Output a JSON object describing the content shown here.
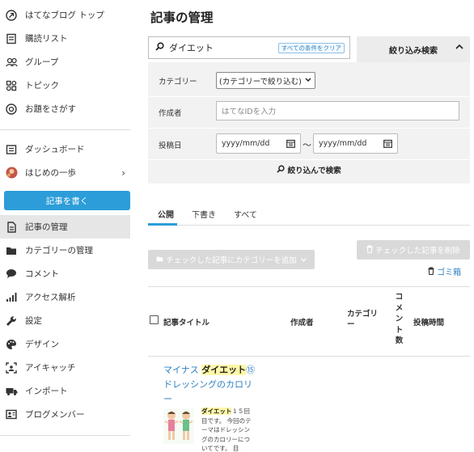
{
  "sidebar": {
    "items": [
      {
        "label": "はてなブログ トップ",
        "icon": "hatena-blog-icon"
      },
      {
        "label": "購読リスト",
        "icon": "reader-icon"
      },
      {
        "label": "グループ",
        "icon": "group-icon"
      },
      {
        "label": "トピック",
        "icon": "topic-icon"
      },
      {
        "label": "お題をさがす",
        "icon": "odai-icon"
      },
      {
        "label": "ダッシュボード",
        "icon": "dashboard-icon"
      },
      {
        "label": "はじめの一歩",
        "icon": "blog-avatar-icon"
      },
      {
        "label": "記事の管理",
        "icon": "document-icon"
      },
      {
        "label": "カテゴリーの管理",
        "icon": "folder-icon"
      },
      {
        "label": "コメント",
        "icon": "comment-icon"
      },
      {
        "label": "アクセス解析",
        "icon": "analytics-icon"
      },
      {
        "label": "設定",
        "icon": "wrench-icon"
      },
      {
        "label": "デザイン",
        "icon": "palette-icon"
      },
      {
        "label": "アイキャッチ",
        "icon": "eyecatch-icon"
      },
      {
        "label": "インポート",
        "icon": "truck-icon"
      },
      {
        "label": "ブログメンバー",
        "icon": "member-icon"
      }
    ],
    "write_button": "記事を書く",
    "active": "記事の管理"
  },
  "main": {
    "title": "記事の管理",
    "search": {
      "value": "ダイエット",
      "clear_label": "すべての条件をクリア"
    },
    "filter_toggle": "絞り込み検索",
    "filter": {
      "category_label": "カテゴリー",
      "category_value": "(カテゴリーで絞り込む)",
      "author_label": "作成者",
      "author_placeholder": "はてなIDを入力",
      "date_label": "投稿日",
      "date_from": "yyyy/mm/dd",
      "date_to": "yyyy/mm/dd",
      "range_sep": "〜",
      "submit": "絞り込んで検索"
    },
    "tabs": [
      "公開",
      "下書き",
      "すべて"
    ],
    "buttons": {
      "delete": "チェックした記事を削除",
      "add_category": "チェックした記事にカテゴリーを追加",
      "trash": "ゴミ箱"
    },
    "table_headers": {
      "title": "記事タイトル",
      "author": "作成者",
      "category": "カテゴリー",
      "comments": "コメント数",
      "time": "投稿時間"
    },
    "post": {
      "title_pre": "マイナス ",
      "title_hl": "ダイエット",
      "title_post": "⑮ ドレッシングのカロリー",
      "excerpt_hl": "ダイエット",
      "excerpt": "１５回目です。 今回のテーマはドレッシングのカロリーについてです。 目"
    }
  }
}
